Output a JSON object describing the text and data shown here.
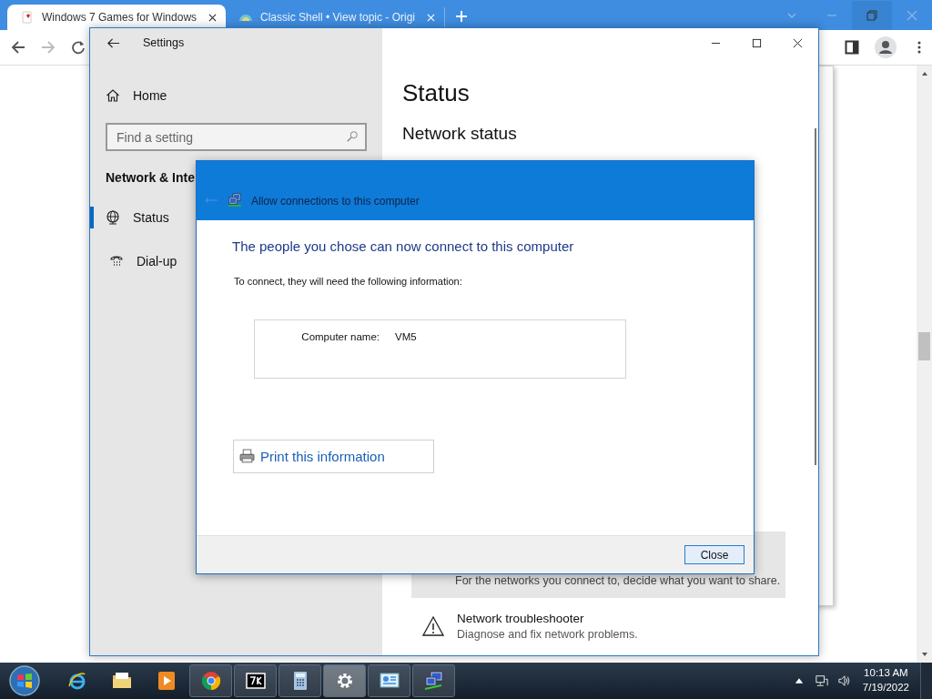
{
  "browser": {
    "tabs": [
      {
        "title": "Windows 7 Games for Windows",
        "selected": true,
        "kind": "cards"
      },
      {
        "title": "Classic Shell • View topic - Origi",
        "selected": false,
        "kind": "shell"
      }
    ]
  },
  "settings": {
    "title": "Settings",
    "home": "Home",
    "search": {
      "placeholder": "Find a setting"
    },
    "section": "Network & Inte",
    "nav": [
      {
        "label": "Status",
        "selected": true,
        "kind": "globe"
      },
      {
        "label": "Dial-up",
        "selected": false,
        "kind": "phone"
      }
    ],
    "heading": "Status",
    "subheading": "Network status",
    "sharing_text": "For the networks you connect to, decide what you want to share.",
    "troubleshooter": {
      "title": "Network troubleshooter",
      "description": "Diagnose and fix network problems."
    }
  },
  "dialog": {
    "title": "Allow connections to this computer",
    "heading": "The people you chose can now connect to this computer",
    "instruction": "To connect, they will need the following information:",
    "fields": [
      {
        "label": "Computer name:",
        "value": "VM5"
      }
    ],
    "print_button": "Print this information",
    "close_button": "Close"
  },
  "taskbar": {
    "apps": [
      {
        "kind": "ie",
        "running": false,
        "active": false
      },
      {
        "kind": "folder",
        "running": false,
        "active": false
      },
      {
        "kind": "media",
        "running": false,
        "active": false
      },
      {
        "kind": "chrome",
        "running": true,
        "active": false
      },
      {
        "kind": "zip",
        "running": true,
        "active": false
      },
      {
        "kind": "calculator",
        "running": true,
        "active": false
      },
      {
        "kind": "gear",
        "running": true,
        "active": true
      },
      {
        "kind": "panel",
        "running": true,
        "active": false
      },
      {
        "kind": "network",
        "running": true,
        "active": false
      }
    ],
    "time": "10:13 AM",
    "date": "7/19/2022"
  }
}
